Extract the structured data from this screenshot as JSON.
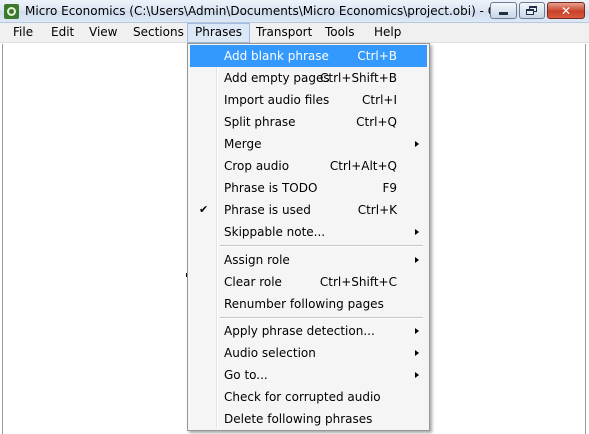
{
  "window": {
    "title": "Micro Economics (C:\\Users\\Admin\\Documents\\Micro Economics\\project.obi) - Obi",
    "close_glyph": "✕"
  },
  "menubar": {
    "items": [
      {
        "label": "File"
      },
      {
        "label": "Edit"
      },
      {
        "label": "View"
      },
      {
        "label": "Sections"
      },
      {
        "label": "Phrases",
        "active": true
      },
      {
        "label": "Transport"
      },
      {
        "label": "Tools"
      },
      {
        "label": "Help"
      }
    ]
  },
  "phrases_menu": {
    "items": [
      {
        "label": "Add blank phrase",
        "shortcut": "Ctrl+B",
        "highlighted": true
      },
      {
        "label": "Add empty pages",
        "shortcut": "Ctrl+Shift+B"
      },
      {
        "label": "Import audio files",
        "shortcut": "Ctrl+I"
      },
      {
        "label": "Split phrase",
        "shortcut": "Ctrl+Q"
      },
      {
        "label": "Merge",
        "shortcut": "",
        "submenu": true
      },
      {
        "label": "Crop audio",
        "shortcut": "Ctrl+Alt+Q"
      },
      {
        "label": "Phrase is TODO",
        "shortcut": "F9"
      },
      {
        "label": "Phrase is used",
        "shortcut": "Ctrl+K",
        "checked": true,
        "check_glyph": "✔"
      },
      {
        "label": "Skippable note...",
        "shortcut": "",
        "submenu": true
      },
      {
        "label": "Assign role",
        "shortcut": "",
        "submenu": true
      },
      {
        "label": "Clear role",
        "shortcut": "Ctrl+Shift+C"
      },
      {
        "label": "Renumber following pages",
        "shortcut": ""
      },
      {
        "label": "Apply phrase detection...",
        "shortcut": "",
        "submenu": true
      },
      {
        "label": "Audio selection",
        "shortcut": "",
        "submenu": true
      },
      {
        "label": "Go to...",
        "shortcut": "",
        "submenu": true
      },
      {
        "label": "Check for corrupted audio",
        "shortcut": ""
      },
      {
        "label": "Delete following phrases",
        "shortcut": ""
      }
    ]
  },
  "colors": {
    "highlight": "#3399ff",
    "menu_background": "#f5f5f5",
    "menubar_background": "#f0f0f0",
    "close_button": "#c8412a"
  }
}
